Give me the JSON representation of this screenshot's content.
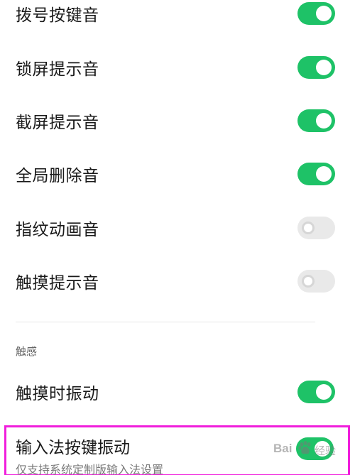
{
  "sound_items": [
    {
      "label": "拨号按键音",
      "enabled": true
    },
    {
      "label": "锁屏提示音",
      "enabled": true
    },
    {
      "label": "截屏提示音",
      "enabled": true
    },
    {
      "label": "全局删除音",
      "enabled": true
    },
    {
      "label": "指纹动画音",
      "enabled": false
    },
    {
      "label": "触摸提示音",
      "enabled": false
    }
  ],
  "haptics": {
    "section_title": "触感",
    "touch_vibration": {
      "label": "触摸时振动",
      "enabled": true
    },
    "keyboard_vibration": {
      "label": "输入法按键振动",
      "description": "仅支持系统定制版输入法设置",
      "enabled": true
    }
  },
  "colors": {
    "toggle_on": "#1ec267",
    "toggle_off": "#e9e9e9",
    "highlight_border": "#f01edc"
  },
  "watermark": {
    "text_left": "Bai",
    "text_right": "经验"
  }
}
